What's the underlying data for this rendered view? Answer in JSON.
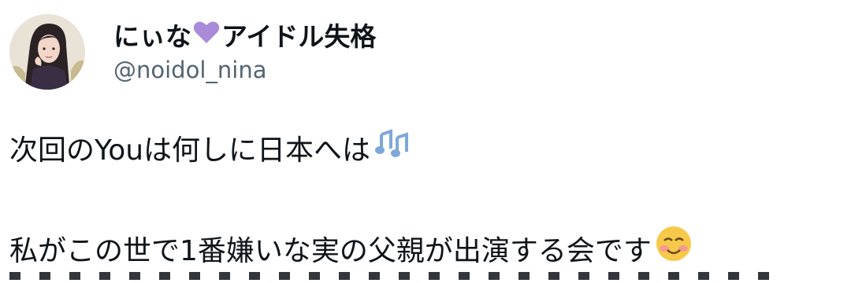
{
  "author": {
    "display_name_part1": "にぃな",
    "display_name_part2": "アイドル失格",
    "handle": "@noidol_nina",
    "heart_color": "#a98bd9"
  },
  "tweet": {
    "line1": "次回のYouは何しに日本へは",
    "line1_emoji": "music-notes-icon",
    "line2": "私がこの世で1番嫌いな実の父親が出演する会です",
    "line2_emoji": "smiling-blush-face-icon"
  }
}
